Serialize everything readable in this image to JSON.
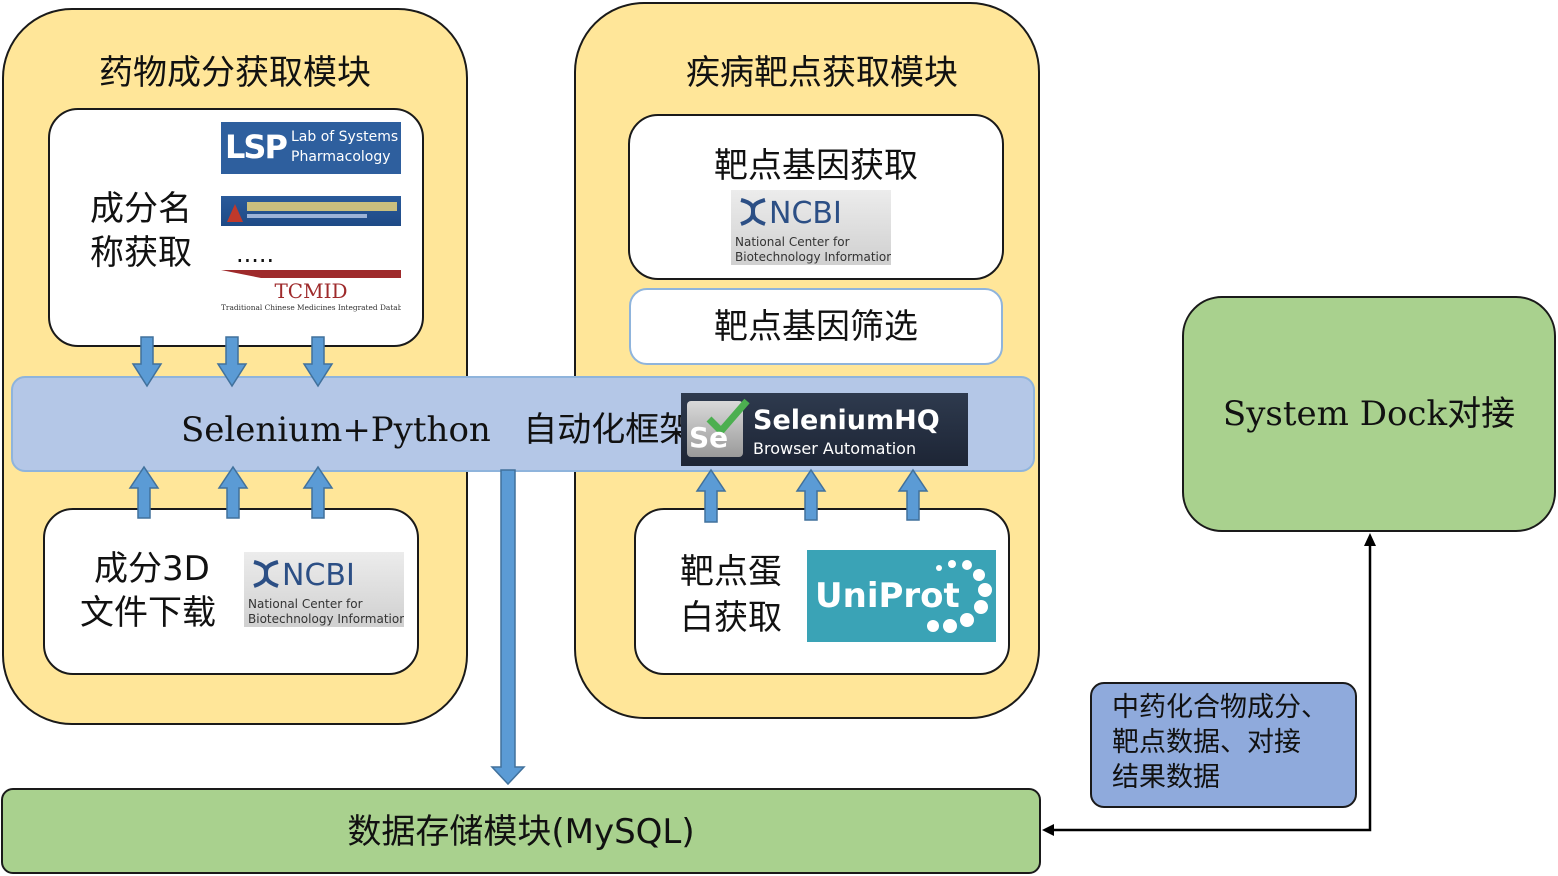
{
  "drug_module": {
    "title": "药物成分获取模块",
    "name_card": {
      "label_line1": "成分名",
      "label_line2": "称获取",
      "ellipsis": ".....",
      "lsp_logo": {
        "mark": "LSP",
        "line1": "Lab of Systems",
        "line2": "Pharmacology"
      },
      "tcmid_logo": {
        "mark": "TCMID",
        "subtitle": "Traditional Chinese Medicines Integrated Database"
      }
    },
    "download_card": {
      "label_line1": "成分3D",
      "label_line2": "文件下载",
      "ncbi_logo": {
        "mark": "NCBI",
        "line1": "National Center for",
        "line2": "Biotechnology Information"
      }
    }
  },
  "disease_module": {
    "title": "疾病靶点获取模块",
    "gene_card": {
      "label": "靶点基因获取",
      "ncbi_logo": {
        "mark": "NCBI",
        "line1": "National Center for",
        "line2": "Biotechnology Information"
      }
    },
    "filter_card": {
      "label": "靶点基因筛选"
    },
    "protein_card": {
      "label_line1": "靶点蛋",
      "label_line2": "白获取",
      "uniprot_logo": {
        "mark": "UniProt"
      }
    }
  },
  "framework": {
    "label": "Selenium+Python   自动化框架",
    "selenium_logo": {
      "icon_text": "Se",
      "name": "SeleniumHQ",
      "subtitle": "Browser Automation"
    }
  },
  "storage": {
    "label": "数据存储模块(MySQL)"
  },
  "docking": {
    "label": "System Dock对接"
  },
  "note": {
    "line1": "中药化合物成分、",
    "line2": "靶点数据、对接",
    "line3": "结果数据"
  },
  "colors": {
    "module_fill": "#ffe699",
    "framework_fill": "#b4c7e7",
    "green_fill": "#a9d18e",
    "note_fill": "#8faadc",
    "arrow_blue": "#5b9bd5"
  }
}
